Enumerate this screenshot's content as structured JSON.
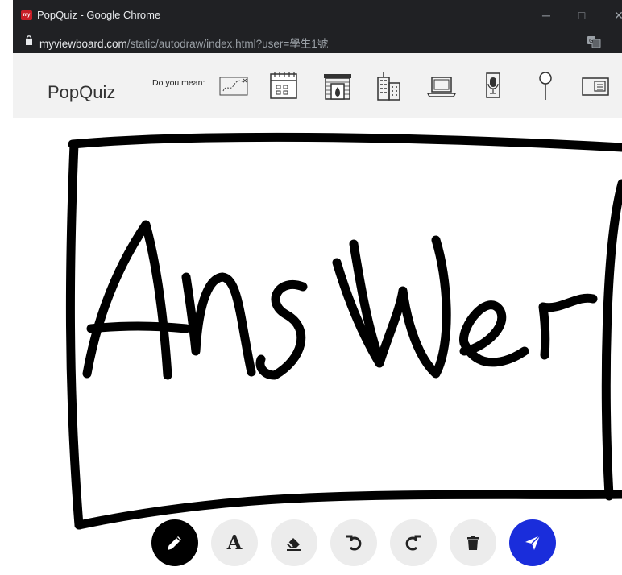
{
  "window": {
    "title": "PopQuiz - Google Chrome",
    "favicon_text": "my",
    "minimize_glyph": "─",
    "maximize_glyph": "□",
    "close_glyph": "✕"
  },
  "address_bar": {
    "host": "myviewboard.com",
    "path": "/static/autodraw/index.html?user=學生1號"
  },
  "toolbar": {
    "app_title": "PopQuiz",
    "suggestion_label": "Do you mean:",
    "suggestions": [
      "scribble-icon",
      "calendar-icon",
      "fireplace-icon",
      "building-icon",
      "laptop-icon",
      "microphone-icon",
      "pin-icon",
      "card-icon"
    ]
  },
  "canvas": {
    "handwritten_text": "AnsWer"
  },
  "tools": {
    "text_tool_label": "A",
    "items": [
      "pen-tool",
      "text-tool",
      "eraser-tool",
      "undo",
      "redo",
      "delete",
      "send"
    ],
    "active": "pen-tool"
  },
  "colors": {
    "chrome_bar": "#202124",
    "toolbar_bg": "#f2f2f2",
    "tool_button": "#ececec",
    "active_tool": "#000000",
    "send_button": "#1a2ddb",
    "ink": "#000000"
  }
}
